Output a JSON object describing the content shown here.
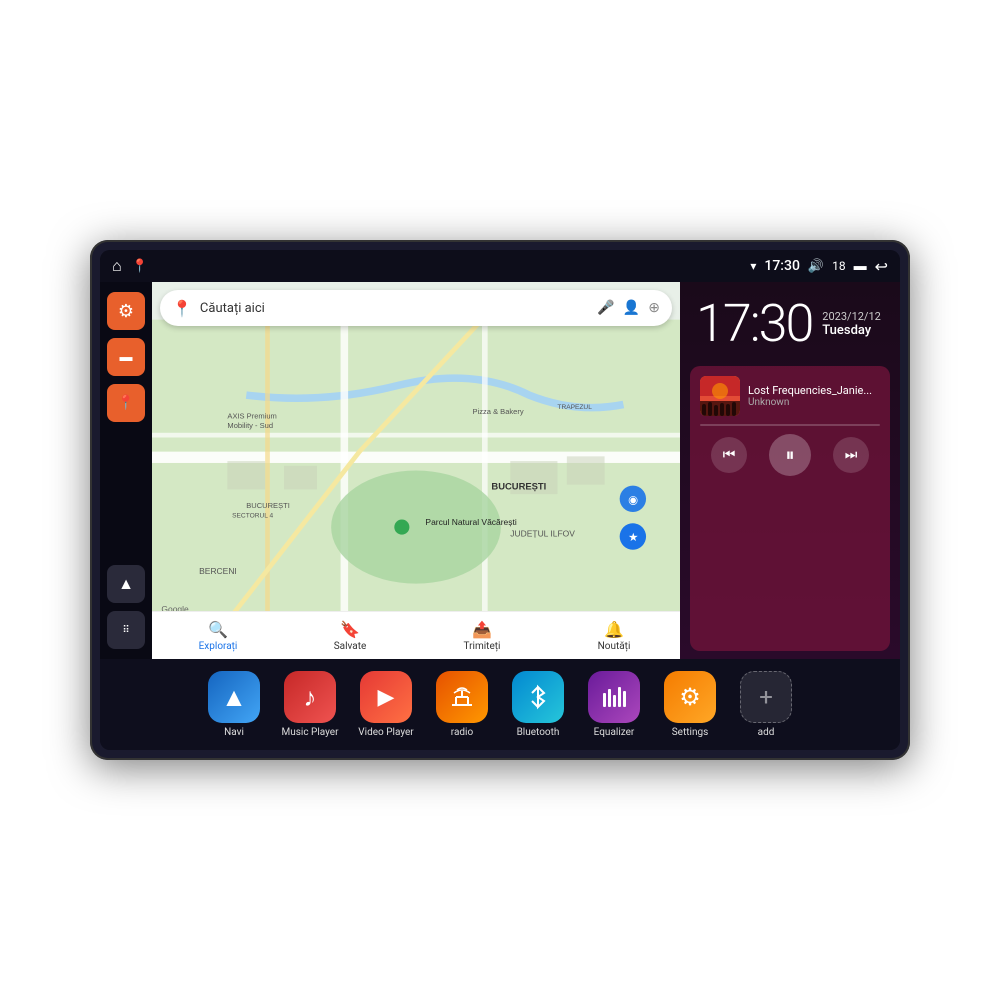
{
  "device": {
    "status_bar": {
      "wifi_icon": "▾",
      "time": "17:30",
      "volume_icon": "🔊",
      "battery_level": "18",
      "battery_icon": "🔋",
      "back_icon": "↩"
    },
    "sidebar": {
      "buttons": [
        {
          "id": "settings",
          "icon": "⚙",
          "color": "orange",
          "label": "Settings"
        },
        {
          "id": "files",
          "icon": "▬",
          "color": "orange",
          "label": "Files"
        },
        {
          "id": "maps",
          "icon": "📍",
          "color": "orange",
          "label": "Maps"
        },
        {
          "id": "navi",
          "icon": "▲",
          "color": "dark",
          "label": "Navigation"
        },
        {
          "id": "grid",
          "icon": "⋮⋮⋮",
          "color": "dark",
          "label": "Grid"
        }
      ]
    },
    "map": {
      "search_placeholder": "Căutați aici",
      "location_labels": [
        "AXIS Premium Mobility - Sud",
        "Pizza & Bakery",
        "TRAPEZUL",
        "Parcul Natural Văcărești",
        "BUCUREȘTI",
        "SECTORUL 4",
        "JUDEȚUL ILFOV",
        "BERCENI"
      ],
      "bottom_nav": [
        {
          "label": "Explorați",
          "icon": "🔍",
          "active": true
        },
        {
          "label": "Salvate",
          "icon": "🔖",
          "active": false
        },
        {
          "label": "Trimiteți",
          "icon": "📤",
          "active": false
        },
        {
          "label": "Noutăți",
          "icon": "🔔",
          "active": false
        }
      ]
    },
    "clock": {
      "time": "17:30",
      "date_line1": "2023/12/12",
      "date_line2": "Tuesday"
    },
    "music": {
      "title": "Lost Frequencies_Janie...",
      "artist": "Unknown",
      "controls": {
        "prev": "⏮",
        "play": "⏸",
        "next": "⏭"
      }
    },
    "apps": [
      {
        "id": "navi",
        "label": "Navi",
        "icon": "▲",
        "color_class": "icon-blue"
      },
      {
        "id": "music",
        "label": "Music Player",
        "icon": "♪",
        "color_class": "icon-red"
      },
      {
        "id": "video",
        "label": "Video Player",
        "icon": "▶",
        "color_class": "icon-orange-red"
      },
      {
        "id": "radio",
        "label": "radio",
        "icon": "📶",
        "color_class": "icon-orange"
      },
      {
        "id": "bluetooth",
        "label": "Bluetooth",
        "icon": "᪥",
        "color_class": "icon-cyan-blue"
      },
      {
        "id": "equalizer",
        "label": "Equalizer",
        "icon": "⏸",
        "color_class": "icon-purple"
      },
      {
        "id": "settings",
        "label": "Settings",
        "icon": "⚙",
        "color_class": "icon-orange2"
      },
      {
        "id": "add",
        "label": "add",
        "icon": "+",
        "color_class": "icon-grid"
      }
    ]
  }
}
